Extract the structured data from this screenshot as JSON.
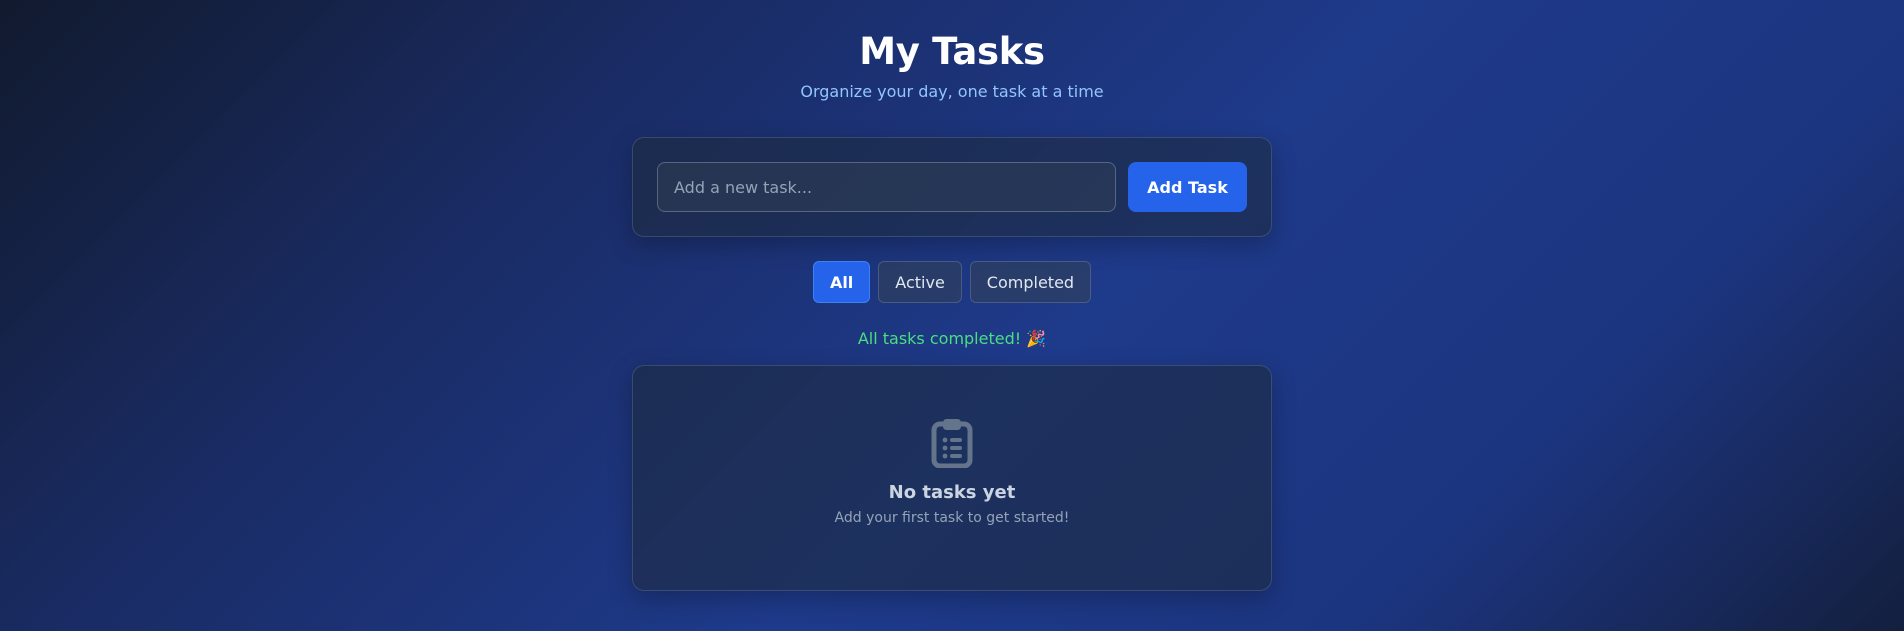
{
  "header": {
    "title": "My Tasks",
    "subtitle": "Organize your day, one task at a time"
  },
  "new_task": {
    "placeholder": "Add a new task...",
    "value": "",
    "add_label": "Add Task"
  },
  "filters": {
    "selected": "All",
    "items": [
      {
        "label": "All"
      },
      {
        "label": "Active"
      },
      {
        "label": "Completed"
      }
    ]
  },
  "status": {
    "message": "All tasks completed!",
    "emoji": "🎉"
  },
  "empty_state": {
    "icon": "clipboard-list-icon",
    "title": "No tasks yet",
    "subtitle": "Add your first task to get started!"
  },
  "colors": {
    "accent": "#2563eb",
    "subtitle": "#93c5fd",
    "success": "#4ade80",
    "icon_muted": "#64748b"
  }
}
